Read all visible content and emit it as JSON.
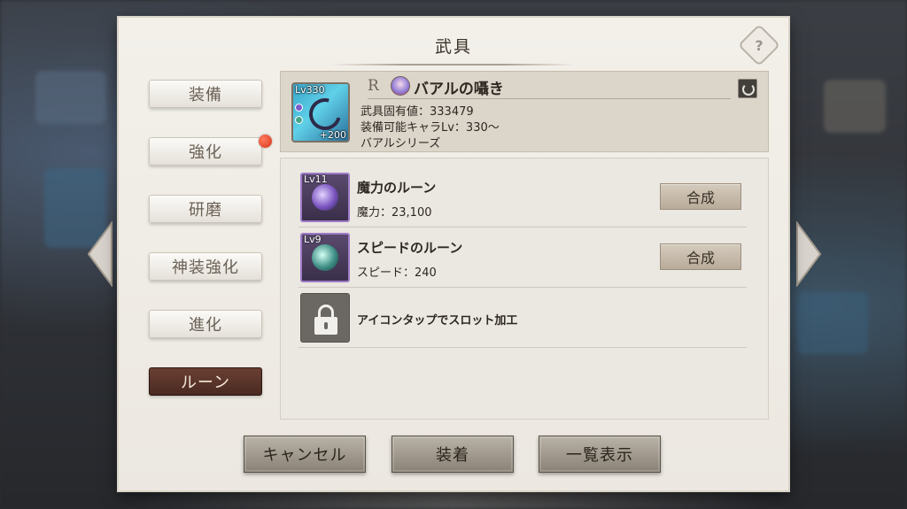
{
  "dialog": {
    "title": "武具"
  },
  "tabs": [
    {
      "label": "装備"
    },
    {
      "label": "強化"
    },
    {
      "label": "研磨"
    },
    {
      "label": "神装強化"
    },
    {
      "label": "進化"
    },
    {
      "label": "ルーン"
    }
  ],
  "active_tab": "ルーン",
  "item": {
    "level": "Lv330",
    "plus": "+200",
    "rarity": "R",
    "name": "バアルの囁き",
    "stat_value": "武具固有値：333479",
    "required_level": "装備可能キャラLv：330〜",
    "series": "バアルシリーズ"
  },
  "runes": [
    {
      "level": "Lv11",
      "name": "魔力のルーン",
      "stat": "魔力：23,100",
      "button": "合成",
      "color": "#7a55c0"
    },
    {
      "level": "Lv9",
      "name": "スピードのルーン",
      "stat": "スピード：240",
      "button": "合成",
      "color": "#3f8f86"
    }
  ],
  "locked_slot": {
    "text": "アイコンタップでスロット加工"
  },
  "buttons": {
    "cancel": "キャンセル",
    "equip": "装着",
    "list": "一覧表示"
  },
  "help_icon": "?"
}
